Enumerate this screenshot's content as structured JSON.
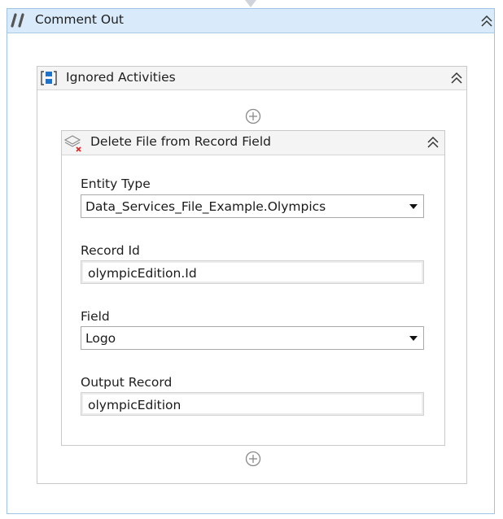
{
  "comment_out": {
    "title": "Comment Out",
    "ignored_activities": {
      "title": "Ignored Activities",
      "activity": {
        "title": "Delete File from Record Field",
        "fields": [
          {
            "label": "Entity Type",
            "value": "Data_Services_File_Example.Olympics"
          },
          {
            "label": "Record Id",
            "value": "olympicEdition.Id"
          },
          {
            "label": "Field",
            "value": "Logo"
          },
          {
            "label": "Output Record",
            "value": "olympicEdition"
          }
        ]
      }
    }
  },
  "icons": {
    "comment_out": "comment-slashes-icon",
    "ignored_activities": "sequence-icon",
    "activity": "delete-file-icon",
    "collapse": "double-chevron-up-icon",
    "add": "add-activity-icon",
    "dropdown": "dropdown-arrow-icon"
  },
  "colors": {
    "outer_header_bg": "#d9ebfa",
    "outer_border": "#9ec3e6",
    "inner_header_bg": "#f4f4f4",
    "accent_blue": "#1e73c8",
    "delete_red": "#e0282a"
  }
}
